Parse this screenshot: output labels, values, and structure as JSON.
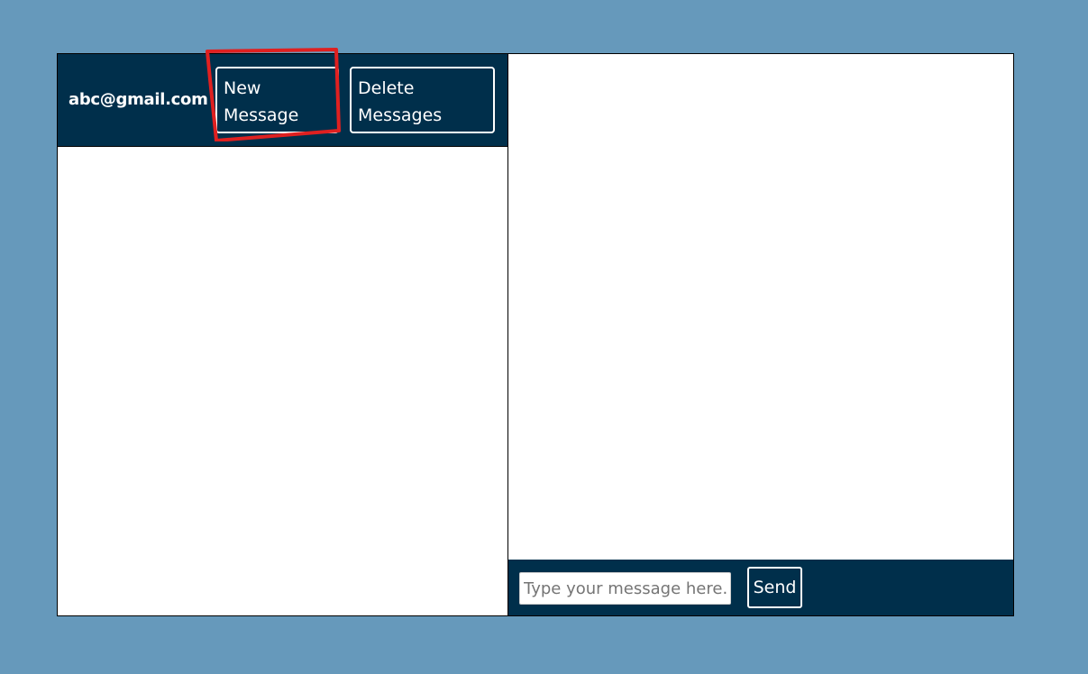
{
  "header": {
    "user_email": "abc@gmail.com",
    "new_message_line1": "New",
    "new_message_line2": "Message",
    "delete_messages_line1": "Delete",
    "delete_messages_line2": "Messages"
  },
  "composer": {
    "input_placeholder": "Type your message here...",
    "input_value": "",
    "send_label": "Send"
  },
  "colors": {
    "background": "#6699bb",
    "header_bg": "#002f4b",
    "highlight": "#e02020"
  }
}
